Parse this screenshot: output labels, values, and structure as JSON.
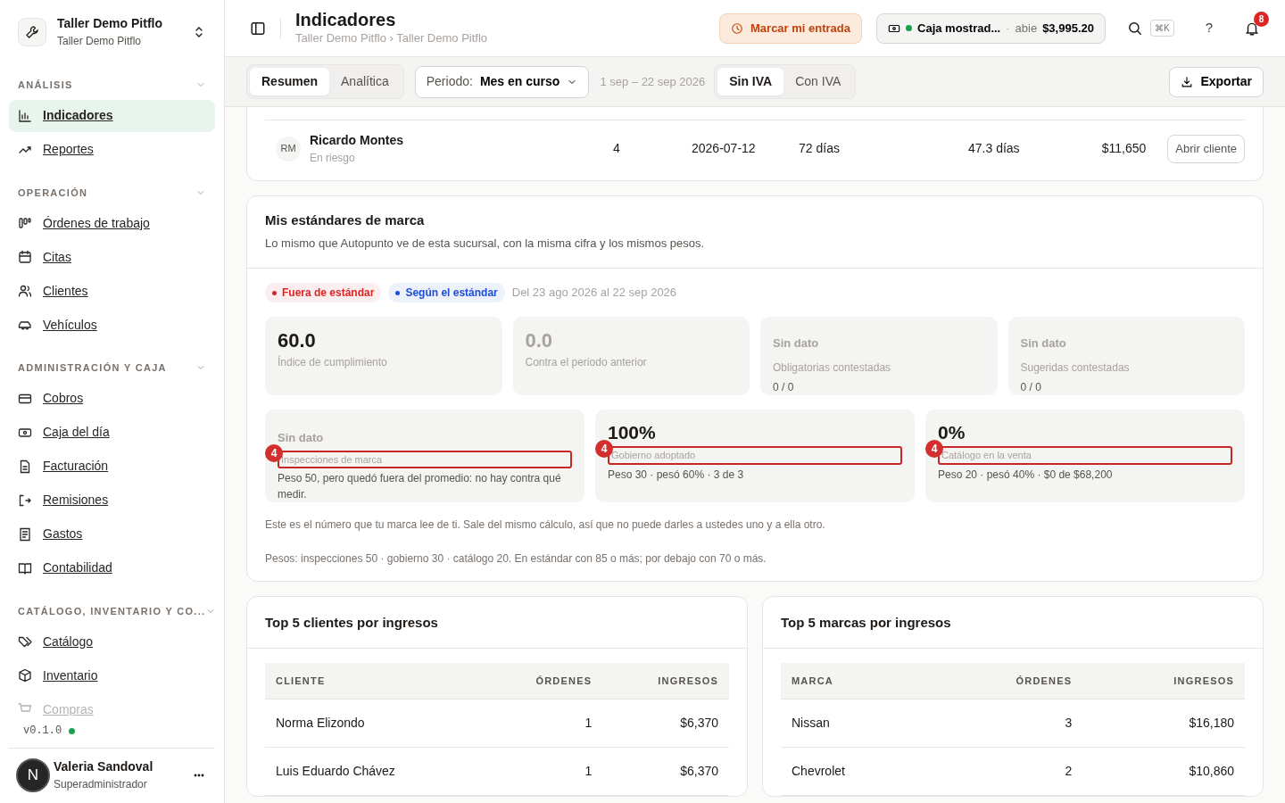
{
  "workspace": {
    "name": "Taller Demo Pitflo",
    "subtitle": "Taller Demo Pitflo"
  },
  "sidebar": {
    "sections": [
      {
        "title": "ANÁLISIS",
        "expanded": true,
        "items": [
          {
            "label": "Indicadores",
            "selected": true,
            "faded": false
          },
          {
            "label": "Reportes",
            "selected": false,
            "faded": false
          }
        ]
      },
      {
        "title": "OPERACIÓN",
        "expanded": true,
        "items": [
          {
            "label": "Órdenes de trabajo",
            "selected": false,
            "faded": false
          },
          {
            "label": "Citas",
            "selected": false,
            "faded": false
          },
          {
            "label": "Clientes",
            "selected": false,
            "faded": false
          },
          {
            "label": "Vehículos",
            "selected": false,
            "faded": false
          }
        ]
      },
      {
        "title": "ADMINISTRACIÓN Y CAJA",
        "expanded": true,
        "items": [
          {
            "label": "Cobros",
            "selected": false,
            "faded": false
          },
          {
            "label": "Caja del día",
            "selected": false,
            "faded": false
          },
          {
            "label": "Facturación",
            "selected": false,
            "faded": false
          },
          {
            "label": "Remisiones",
            "selected": false,
            "faded": false
          },
          {
            "label": "Gastos",
            "selected": false,
            "faded": false
          },
          {
            "label": "Contabilidad",
            "selected": false,
            "faded": false
          }
        ]
      },
      {
        "title": "CATÁLOGO, INVENTARIO Y CO...",
        "expanded": true,
        "items": [
          {
            "label": "Catálogo",
            "selected": false,
            "faded": false
          },
          {
            "label": "Inventario",
            "selected": false,
            "faded": false
          },
          {
            "label": "Compras",
            "selected": false,
            "faded": true
          }
        ]
      }
    ],
    "version": "v0.1.0",
    "online": true
  },
  "user": {
    "initial": "N",
    "name": "Valeria Sandoval",
    "role": "Superadministrador"
  },
  "header": {
    "title": "Indicadores",
    "breadcrumb": "Taller Demo Pitflo › Taller Demo Pitflo",
    "clock_in": "Marcar mi entrada",
    "register": {
      "name": "Caja mostrad...",
      "open": true,
      "separator": "·",
      "status": "abie",
      "amount": "$3,995.20"
    },
    "shortcut": "⌘K",
    "help": "?",
    "notifications": "8"
  },
  "toolbar": {
    "views": [
      {
        "label": "Resumen",
        "selected": true
      },
      {
        "label": "Analítica",
        "selected": false
      }
    ],
    "period": {
      "label": "Periodo:",
      "value": "Mes en curso"
    },
    "range": "1 sep – 22 sep 2026",
    "tax": [
      {
        "label": "Sin IVA",
        "selected": true
      },
      {
        "label": "Con IVA",
        "selected": false
      }
    ],
    "export": "Exportar"
  },
  "client_row": {
    "initials": "RM",
    "name": "Ricardo Montes",
    "status": "En riesgo",
    "orders": "4",
    "last_visit": "2026-07-12",
    "days": "72 días",
    "average": "47.3 días",
    "revenue": "$11,650",
    "action": "Abrir cliente"
  },
  "standards": {
    "title": "Mis estándares de marca",
    "subtitle": "Lo mismo que Autopunto ve de esta sucursal, con la misma cifra y los mismos pesos.",
    "legend": [
      {
        "label": "Fuera de estándar",
        "color": "#dc2626"
      },
      {
        "label": "Según el estándar",
        "color": "#1d4ed8"
      }
    ],
    "range": "Del 23 ago 2026 al 22 sep 2026",
    "stats": [
      {
        "kind": "number",
        "muted": false,
        "value": "60.0",
        "label": "Índice de cumplimiento"
      },
      {
        "kind": "number",
        "muted": true,
        "value": "0.0",
        "label": "Contra el periodo anterior"
      },
      {
        "kind": "empty",
        "muted": true,
        "value": "Sin dato",
        "label": "Obligatorias contestadas",
        "detail": "0 / 0"
      },
      {
        "kind": "empty",
        "muted": true,
        "value": "Sin dato",
        "label": "Sugeridas contestadas",
        "detail": "0 / 0"
      }
    ],
    "components": [
      {
        "kind": "empty",
        "value": "Sin dato",
        "label": "Inspecciones de marca",
        "note": "Peso 50, pero quedó fuera del promedio: no hay contra qué medir.",
        "issues": "4"
      },
      {
        "kind": "number",
        "value": "100%",
        "label": "Gobierno adoptado",
        "note": "Peso 30 · pesó 60% · 3 de 3",
        "issues": "4"
      },
      {
        "kind": "number",
        "value": "0%",
        "label": "Catálogo en la venta",
        "note": "Peso 20 · pesó 40% · $0 de $68,200",
        "issues": "4"
      }
    ],
    "notes": [
      "Este es el número que tu marca lee de ti. Sale del mismo cálculo, así que no puede darles a ustedes uno y a ella otro.",
      "Pesos: inspecciones 50 · gobierno 30 · catálogo 20. En estándar con 85 o más; por debajo con 70 o más."
    ]
  },
  "top_tables": [
    {
      "title": "Top 5 clientes por ingresos",
      "columns": [
        "CLIENTE",
        "ÓRDENES",
        "INGRESOS"
      ],
      "rows": [
        [
          "Norma Elizondo",
          "1",
          "$6,370"
        ],
        [
          "Luis Eduardo Chávez",
          "1",
          "$6,370"
        ]
      ]
    },
    {
      "title": "Top 5 marcas por ingresos",
      "columns": [
        "MARCA",
        "ÓRDENES",
        "INGRESOS"
      ],
      "rows": [
        [
          "Nissan",
          "3",
          "$16,180"
        ],
        [
          "Chevrolet",
          "2",
          "$10,860"
        ]
      ]
    }
  ]
}
